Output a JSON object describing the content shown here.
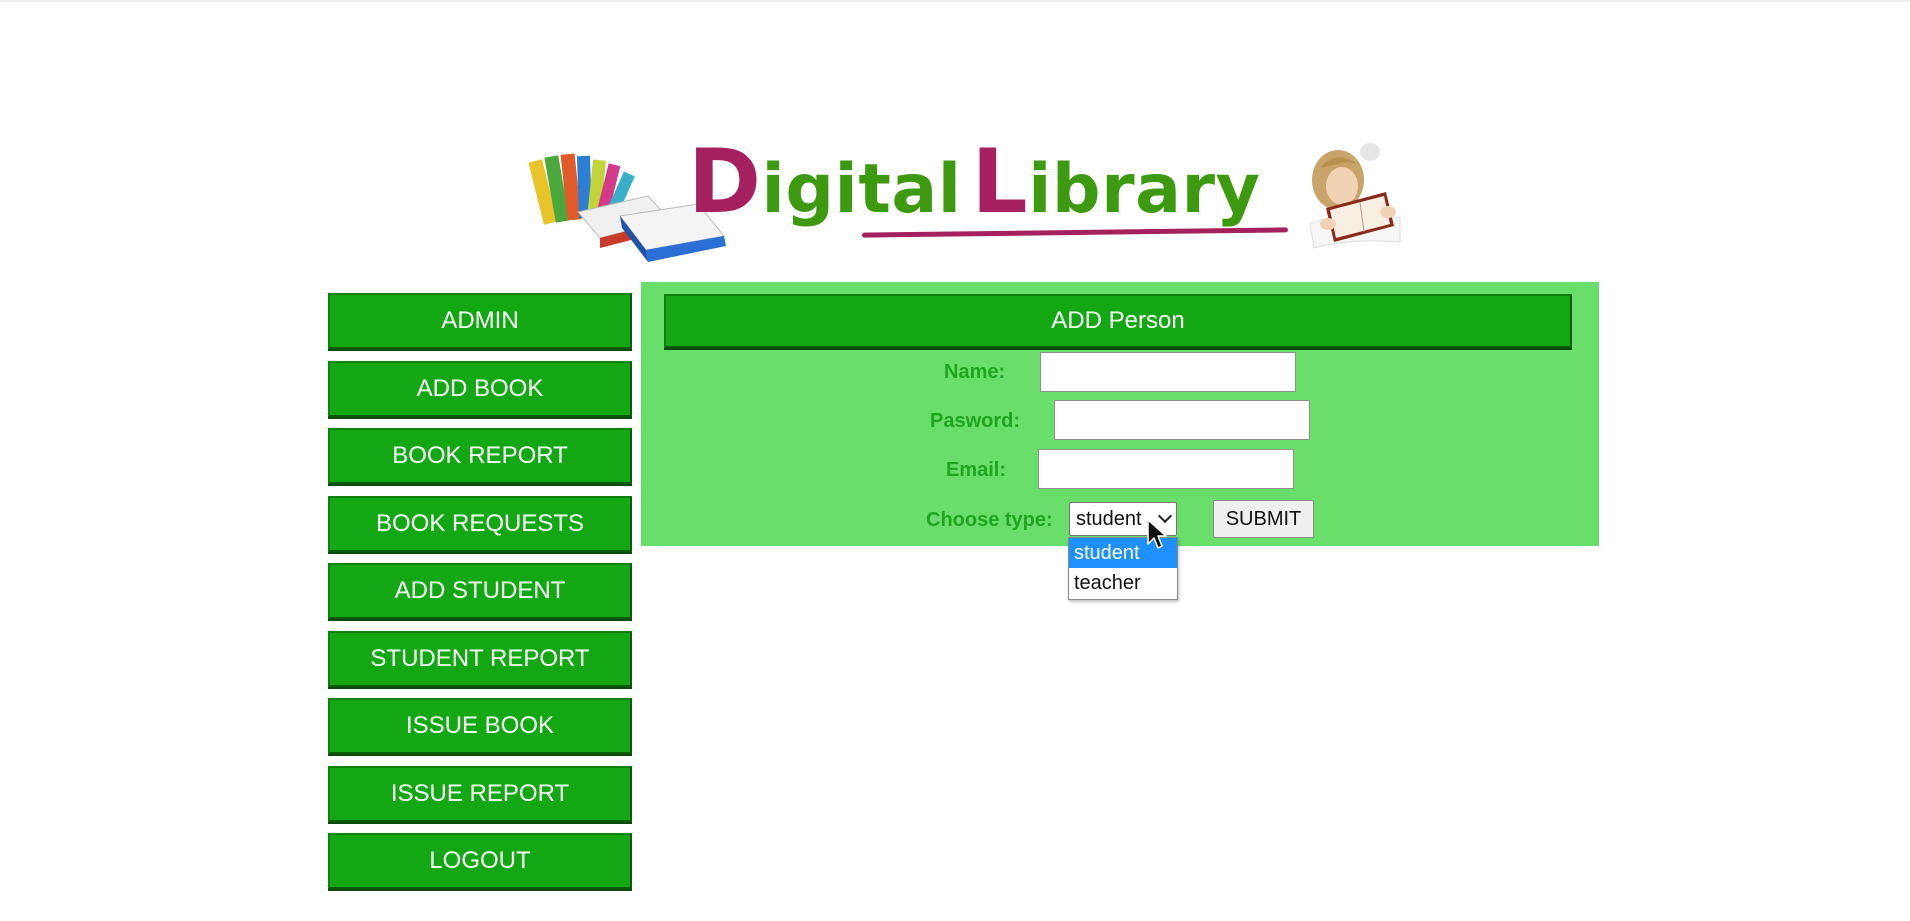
{
  "banner": {
    "logo_prefix_cap": "D",
    "logo_prefix_rest": "igital",
    "logo_suffix_cap": "L",
    "logo_suffix_rest": "ibrary",
    "colors": {
      "green": "#3d9a10",
      "magenta": "#a4205e"
    }
  },
  "sidebar": {
    "items": [
      {
        "label": "ADMIN"
      },
      {
        "label": "ADD BOOK"
      },
      {
        "label": "BOOK REPORT"
      },
      {
        "label": "BOOK REQUESTS"
      },
      {
        "label": "ADD STUDENT"
      },
      {
        "label": "STUDENT REPORT"
      },
      {
        "label": "ISSUE BOOK"
      },
      {
        "label": "ISSUE REPORT"
      },
      {
        "label": "LOGOUT"
      }
    ]
  },
  "form": {
    "title": "ADD Person",
    "name_label": "Name:",
    "name_value": "",
    "password_label": "Pasword:",
    "password_value": "",
    "email_label": "Email:",
    "email_value": "",
    "type_label": "Choose type:",
    "type_selected": "student",
    "type_options": [
      "student",
      "teacher"
    ],
    "submit_label": "SUBMIT"
  },
  "colors": {
    "button_green": "#13a813",
    "panel_green": "#6ade6a",
    "label_green": "#21a421",
    "option_highlight": "#1e90ff"
  },
  "icons": [
    "books-stack-illustration",
    "girl-reading-illustration",
    "chevron-down-icon",
    "mouse-pointer-icon"
  ]
}
